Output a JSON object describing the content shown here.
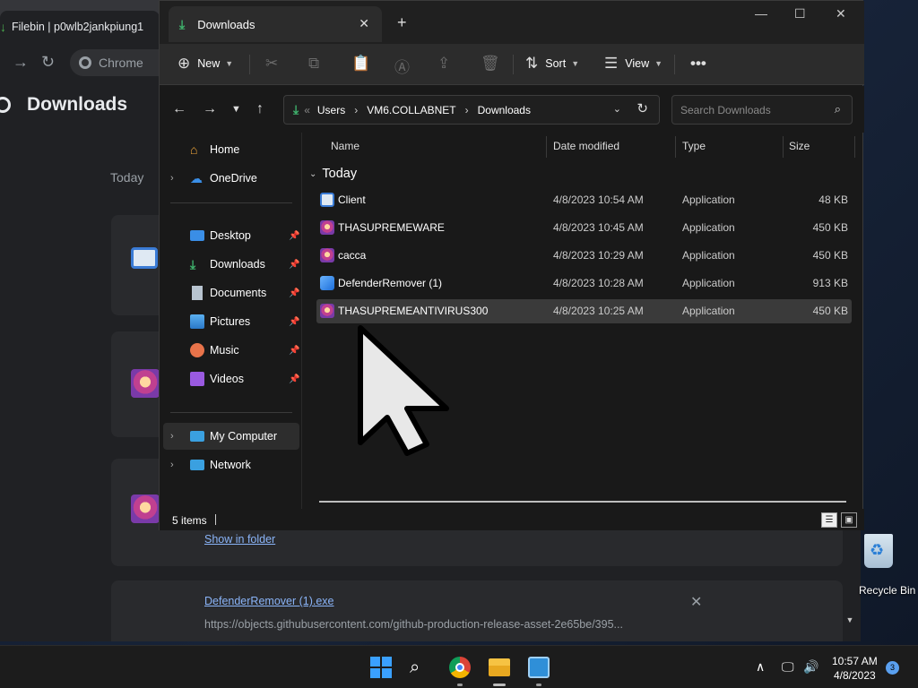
{
  "chrome": {
    "tab_title": "Filebin | p0wlb2jankpiung1",
    "omnibox_chip": "Chrome",
    "page_title": "Downloads",
    "today_label": "Today",
    "cards": [
      {
        "link": "Show in folder"
      },
      {
        "link": "DefenderRemover (1).exe",
        "url": "https://objects.githubusercontent.com/github-production-release-asset-2e65be/395..."
      }
    ],
    "bottom_items_text": "5 items"
  },
  "desktop": {
    "recycle_label": "Recycle Bin"
  },
  "explorer": {
    "tab_title": "Downloads",
    "commands": {
      "new": "New",
      "sort": "Sort",
      "view": "View"
    },
    "breadcrumb": [
      "Users",
      "VM6.COLLABNET",
      "Downloads"
    ],
    "search_placeholder": "Search Downloads",
    "nav": [
      {
        "label": "Home",
        "icon": "home-icon"
      },
      {
        "label": "OneDrive",
        "icon": "cloud-icon"
      },
      {
        "label": "Desktop",
        "icon": "desktop-icon"
      },
      {
        "label": "Downloads",
        "icon": "download-icon"
      },
      {
        "label": "Documents",
        "icon": "document-icon"
      },
      {
        "label": "Pictures",
        "icon": "picture-icon"
      },
      {
        "label": "Music",
        "icon": "music-icon"
      },
      {
        "label": "Videos",
        "icon": "video-icon"
      },
      {
        "label": "My Computer",
        "icon": "computer-icon"
      },
      {
        "label": "Network",
        "icon": "network-icon"
      }
    ],
    "columns": {
      "name": "Name",
      "date": "Date modified",
      "type": "Type",
      "size": "Size"
    },
    "group_label": "Today",
    "files": [
      {
        "name": "Client",
        "date": "4/8/2023 10:54 AM",
        "type": "Application",
        "size": "48 KB"
      },
      {
        "name": "THASUPREMEWARE",
        "date": "4/8/2023 10:45 AM",
        "type": "Application",
        "size": "450 KB"
      },
      {
        "name": "cacca",
        "date": "4/8/2023 10:29 AM",
        "type": "Application",
        "size": "450 KB"
      },
      {
        "name": "DefenderRemover (1)",
        "date": "4/8/2023 10:28 AM",
        "type": "Application",
        "size": "913 KB"
      },
      {
        "name": "THASUPREMEANTIVIRUS300",
        "date": "4/8/2023 10:25 AM",
        "type": "Application",
        "size": "450 KB"
      }
    ],
    "status_count": "5 items"
  },
  "taskbar": {
    "time": "10:57 AM",
    "date": "4/8/2023",
    "notification_count": "3"
  },
  "colors": {
    "accent_green": "#3fb36d",
    "win_blue": "#3aa0ff",
    "link_blue": "#8ab4f8"
  }
}
